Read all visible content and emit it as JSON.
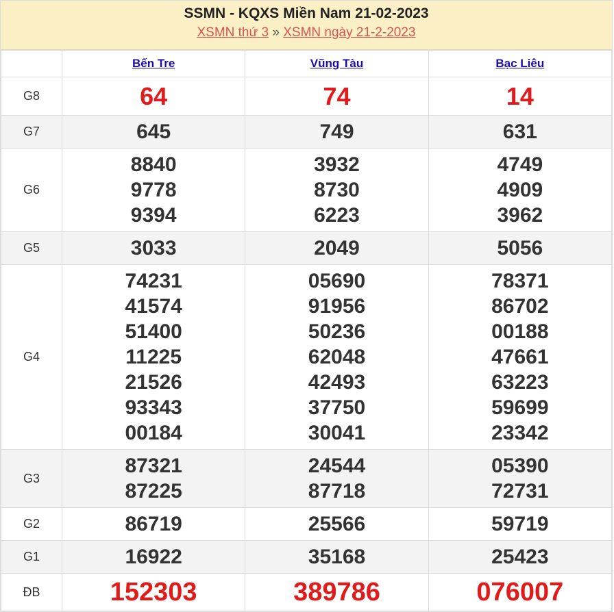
{
  "header": {
    "title": "SSMN - KQXS Miền Nam 21-02-2023",
    "link1": "XSMN thứ 3",
    "separator": "»",
    "link2": "XSMN ngày 21-2-2023"
  },
  "provinces": [
    "Bến Tre",
    "Vũng Tàu",
    "Bạc Liêu"
  ],
  "prizes": [
    {
      "label": "G8",
      "cols": [
        [
          "64"
        ],
        [
          "74"
        ],
        [
          "14"
        ]
      ]
    },
    {
      "label": "G7",
      "cols": [
        [
          "645"
        ],
        [
          "749"
        ],
        [
          "631"
        ]
      ]
    },
    {
      "label": "G6",
      "cols": [
        [
          "8840",
          "9778",
          "9394"
        ],
        [
          "3932",
          "8730",
          "6223"
        ],
        [
          "4749",
          "4909",
          "3962"
        ]
      ]
    },
    {
      "label": "G5",
      "cols": [
        [
          "3033"
        ],
        [
          "2049"
        ],
        [
          "5056"
        ]
      ]
    },
    {
      "label": "G4",
      "cols": [
        [
          "74231",
          "41574",
          "51400",
          "11225",
          "21526",
          "93343",
          "00184"
        ],
        [
          "05690",
          "91956",
          "50236",
          "62048",
          "42493",
          "37750",
          "30041"
        ],
        [
          "78371",
          "86702",
          "00188",
          "47661",
          "63223",
          "59699",
          "23342"
        ]
      ]
    },
    {
      "label": "G3",
      "cols": [
        [
          "87321",
          "87225"
        ],
        [
          "24544",
          "87718"
        ],
        [
          "05390",
          "72731"
        ]
      ]
    },
    {
      "label": "G2",
      "cols": [
        [
          "86719"
        ],
        [
          "25566"
        ],
        [
          "59719"
        ]
      ]
    },
    {
      "label": "G1",
      "cols": [
        [
          "16922"
        ],
        [
          "35168"
        ],
        [
          "25423"
        ]
      ]
    },
    {
      "label": "ĐB",
      "cols": [
        [
          "152303"
        ],
        [
          "389786"
        ],
        [
          "076007"
        ]
      ]
    }
  ],
  "colors": {
    "special": "#e01b1b",
    "link": "#1a0dab",
    "sublink": "#d9534f",
    "header_bg": "#faefc5"
  }
}
